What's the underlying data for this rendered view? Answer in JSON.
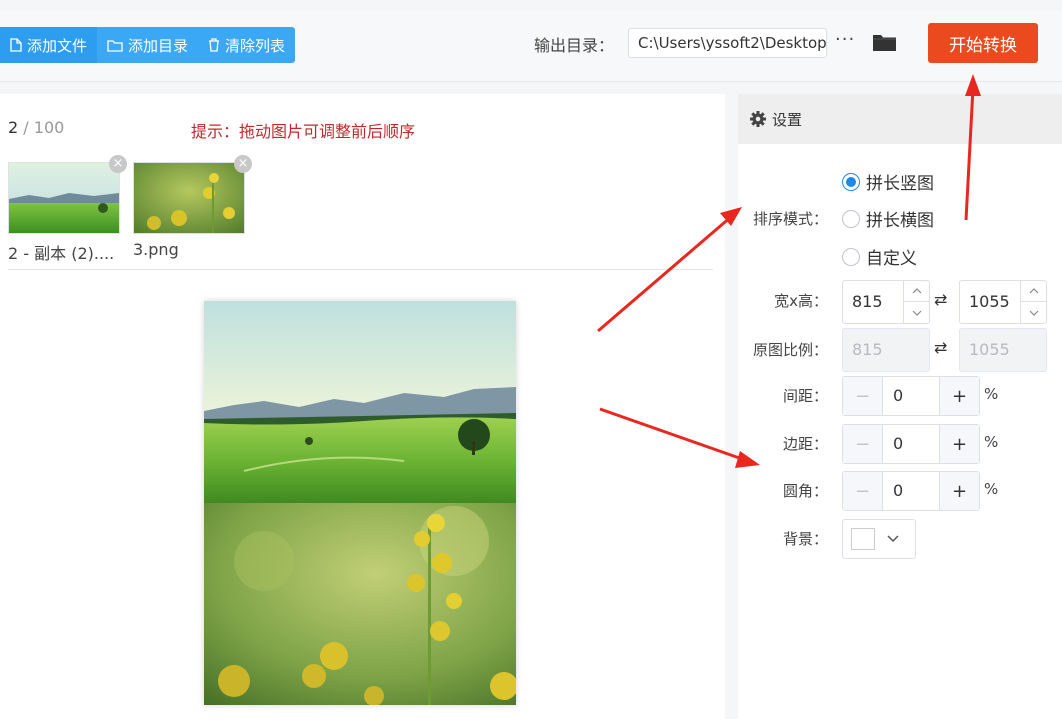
{
  "toolbar": {
    "add_file": "添加文件",
    "add_dir": "添加目录",
    "clear_list": "清除列表",
    "output_label": "输出目录：",
    "output_path": "C:\\Users\\yssoft2\\Desktop",
    "more": "···",
    "start": "开始转换"
  },
  "list": {
    "count_current": "2",
    "count_total": "/ 100",
    "hint": "提示：拖动图片可调整前后顺序",
    "items": [
      {
        "name": "2 - 副本 (2)...."
      },
      {
        "name": "3.png"
      }
    ]
  },
  "settings": {
    "title": "设置",
    "sort_label": "排序模式：",
    "modes": [
      "拼长竖图",
      "拼长横图",
      "自定义"
    ],
    "selected_mode": 0,
    "size_label": "宽x高：",
    "width": "815",
    "height": "1055",
    "orig_label": "原图比例：",
    "orig_width": "815",
    "orig_height": "1055",
    "spacing_label": "间距：",
    "spacing": "0",
    "margin_label": "边距：",
    "margin": "0",
    "radius_label": "圆角：",
    "radius": "0",
    "percent": "%",
    "bg_label": "背景：",
    "bg_color": "#ffffff"
  },
  "colors": {
    "accent": "#3aa8f5",
    "start": "#ea4a1d",
    "hint": "#c0282c",
    "arrow": "#e8271f",
    "radio": "#1e88e5"
  }
}
